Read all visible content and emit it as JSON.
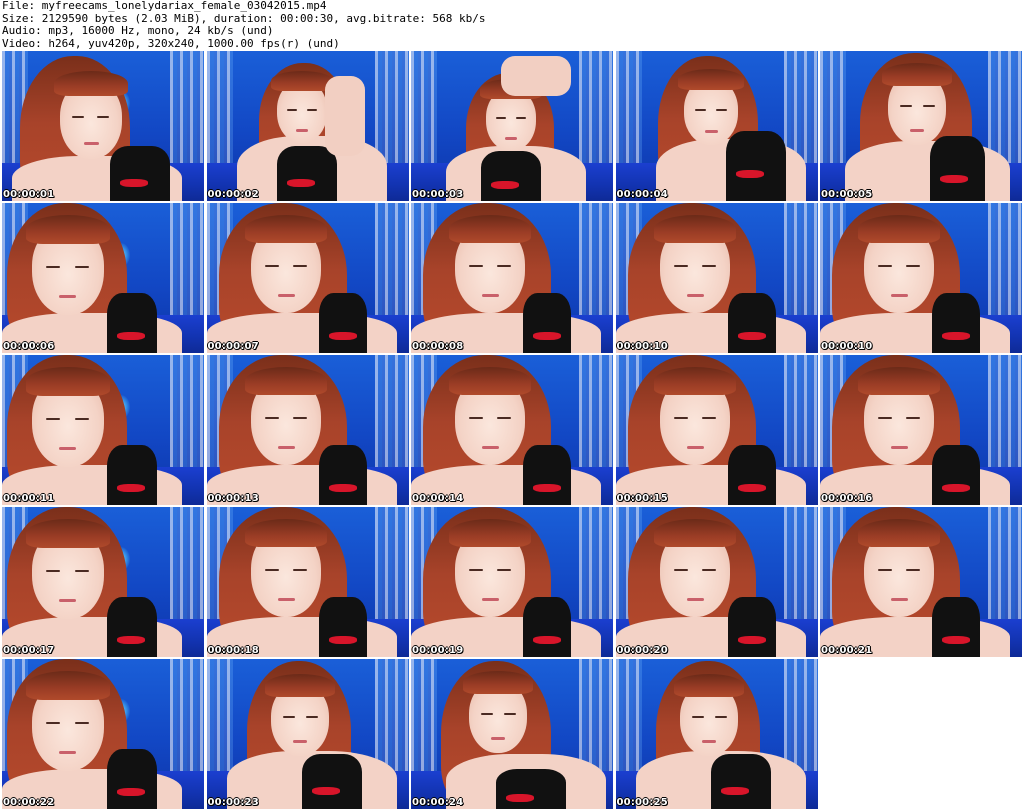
{
  "header": {
    "file_line": "File: myfreecams_lonelydariax_female_03042015.mp4",
    "size_line": "Size: 2129590 bytes (2.03 MiB), duration: 00:00:30, avg.bitrate: 568 kb/s",
    "audio_line": "Audio: mp3, 16000 Hz, mono, 24 kb/s (und)",
    "video_line": "Video: h264, yuv420p, 320x240, 1000.00 fps(r) (und)"
  },
  "thumbnails": [
    {
      "timestamp": "00:00:01",
      "pose": "down-left"
    },
    {
      "timestamp": "00:00:02",
      "pose": "arm-up-right"
    },
    {
      "timestamp": "00:00:03",
      "pose": "hand-on-head"
    },
    {
      "timestamp": "00:00:04",
      "pose": "lean-left"
    },
    {
      "timestamp": "00:00:05",
      "pose": "center"
    },
    {
      "timestamp": "00:00:06",
      "pose": "close-left"
    },
    {
      "timestamp": "00:00:07",
      "pose": "close-center"
    },
    {
      "timestamp": "00:00:08",
      "pose": "close-center"
    },
    {
      "timestamp": "00:00:10",
      "pose": "close-center"
    },
    {
      "timestamp": "00:00:10",
      "pose": "close-center"
    },
    {
      "timestamp": "00:00:11",
      "pose": "close-left"
    },
    {
      "timestamp": "00:00:13",
      "pose": "close-center"
    },
    {
      "timestamp": "00:00:14",
      "pose": "close-center"
    },
    {
      "timestamp": "00:00:15",
      "pose": "close-center"
    },
    {
      "timestamp": "00:00:16",
      "pose": "close-center"
    },
    {
      "timestamp": "00:00:17",
      "pose": "close-left"
    },
    {
      "timestamp": "00:00:18",
      "pose": "close-center"
    },
    {
      "timestamp": "00:00:19",
      "pose": "close-center"
    },
    {
      "timestamp": "00:00:20",
      "pose": "close-center"
    },
    {
      "timestamp": "00:00:21",
      "pose": "close-center"
    },
    {
      "timestamp": "00:00:22",
      "pose": "close-left"
    },
    {
      "timestamp": "00:00:23",
      "pose": "mid-center"
    },
    {
      "timestamp": "00:00:24",
      "pose": "mid-left"
    },
    {
      "timestamp": "00:00:25",
      "pose": "mid-center"
    }
  ],
  "colors": {
    "backdrop_blue": "#1a5fd8",
    "hair_red": "#a8432a",
    "skin": "#f3d2c6",
    "top_black": "#111111",
    "trim_red": "#d8152a",
    "timestamp_text": "#ffffff"
  }
}
